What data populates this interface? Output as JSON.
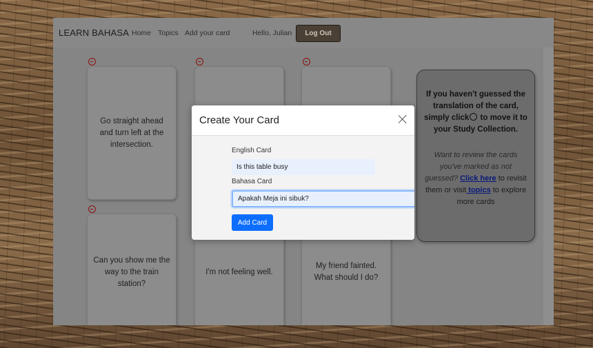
{
  "navbar": {
    "brand": "LEARN BAHASA",
    "links": [
      "Home",
      "Topics",
      "Add your card"
    ],
    "greeting": "Hello, Julian",
    "logout_label": "Log Out"
  },
  "cards": [
    {
      "text": "Go straight ahead and turn left at the intersection."
    },
    {
      "text": ""
    },
    {
      "text": ""
    },
    {
      "text": "Can you show me the way to the train station?"
    },
    {
      "text": "I'm not feeling well."
    },
    {
      "text": "My friend fainted. What should I do?"
    }
  ],
  "info": {
    "head_part1": "If you haven't guessed the translation of the card, simply click",
    "head_part2": " to move it to your Study Collection.",
    "emoji_icon": "frown-face-icon",
    "body_italic": "Want to review the cards you've marked as not guessed?",
    "link_click_here": "Click here",
    "body_mid": " to revisit them or visit",
    "link_topics": " topics",
    "body_end": " to explore more cards"
  },
  "modal": {
    "title": "Create Your Card",
    "english_label": "English Card",
    "english_value": "Is this table busy",
    "bahasa_label": "Bahasa Card",
    "bahasa_value": "Apakah Meja ini sibuk?",
    "submit_label": "Add Card"
  },
  "colors": {
    "primary_button": "#0d6efd",
    "remove_icon": "#8b1010",
    "logout_bg": "#4a4035"
  }
}
